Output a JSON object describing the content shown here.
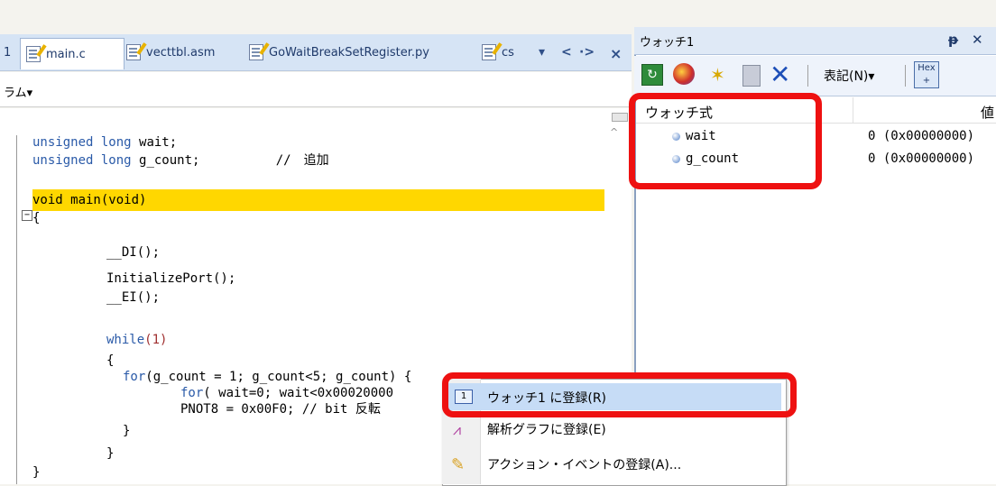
{
  "tabs": [
    {
      "label": "1",
      "file": false
    },
    {
      "label": "main.c",
      "file": true,
      "active": true
    },
    {
      "label": "vecttbl.asm",
      "file": true
    },
    {
      "label": "GoWaitBreakSetRegister.py",
      "file": true
    },
    {
      "label": "cs",
      "file": true
    }
  ],
  "tab_controls": {
    "dropdown": "▾",
    "left": "<",
    "right": "·>",
    "close": "×"
  },
  "subbar": {
    "label": "ラム▾"
  },
  "code": {
    "l1_type": "unsigned long",
    "l1_name": "wait;",
    "l2_type": "unsigned long",
    "l2_name": "g_count;",
    "l2_comment": "//　追加",
    "l3": "void main(void)",
    "l4": "{",
    "l5": "__DI();",
    "l6": "InitializePort();",
    "l7": "__EI();",
    "l8_kw": "while",
    "l8_rest": "(1)",
    "l9": "{",
    "l10_kw": "for",
    "l10_rest": "(g_count = 1; g_count<5; g_count",
    "l10_tail": ") {",
    "l11_kw": "for",
    "l11_rest": "( wait=0; wait<0x00020000",
    "l12": "PNOT8 = 0x00F0; // bit 反転",
    "l13": "}",
    "l14": "}",
    "l15": "}"
  },
  "watch": {
    "title": "ウォッチ1",
    "pin": "ᵽ",
    "close": "✕",
    "notation": "表記(N)▾",
    "hex": "Hex",
    "col_expr": "ウォッチ式",
    "col_value": "値",
    "rows": [
      {
        "name": "wait",
        "value": "0 (0x00000000)"
      },
      {
        "name": "g_count",
        "value": "0 (0x00000000)"
      }
    ]
  },
  "context_menu": {
    "items": [
      {
        "label": "ウォッチ1 に登録(R)",
        "icon": "watch-register-icon"
      },
      {
        "label": "解析グラフに登録(E)",
        "icon": "graph-icon"
      },
      {
        "label": "アクション・イベントの登録(A)...",
        "icon": "action-event-icon"
      }
    ]
  },
  "colors": {
    "highlight": "#ffd700",
    "annotation_red": "#ee1111",
    "keyword": "#2a5aa8"
  }
}
